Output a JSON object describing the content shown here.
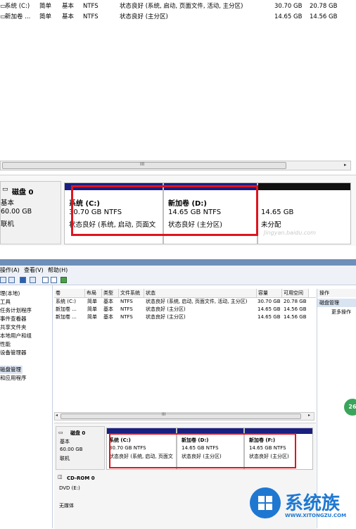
{
  "top": {
    "rows": [
      {
        "name": "系统 (C:)",
        "layout": "简单",
        "type": "基本",
        "fs": "NTFS",
        "status": "状态良好 (系统, 启动, 页面文件, 活动, 主分区)",
        "capacity": "30.70 GB",
        "free": "20.78 GB"
      },
      {
        "name": "新加卷 ...",
        "layout": "简单",
        "type": "基本",
        "fs": "NTFS",
        "status": "状态良好 (主分区)",
        "capacity": "14.65 GB",
        "free": "14.56 GB"
      }
    ],
    "scroll_grip": "III",
    "disk": {
      "title": "磁盘 0",
      "kind": "基本",
      "size": "60.00 GB",
      "state": "联机"
    },
    "partitions": [
      {
        "name": "系统  (C:)",
        "size": "30.70 GB NTFS",
        "status": "状态良好 (系统, 启动, 页面文"
      },
      {
        "name": "新加卷  (D:)",
        "size": "14.65 GB NTFS",
        "status": "状态良好 (主分区)"
      },
      {
        "name": "",
        "size": "14.65 GB",
        "status": "未分配"
      }
    ],
    "watermark": "Jingyan.baidu.com"
  },
  "bottom": {
    "menu": [
      "操作(A)",
      "查看(V)",
      "帮助(H)"
    ],
    "tree": [
      "理(本地)",
      "工具",
      "任务计划程序",
      "事件查看器",
      "共享文件夹",
      "本地用户和组",
      "性能",
      "设备管理器",
      "磁盘管理",
      "和应用程序"
    ],
    "columns": [
      "卷",
      "布局",
      "类型",
      "文件系统",
      "状态",
      "容量",
      "可用空间",
      "操作"
    ],
    "rows": [
      {
        "name": "系统 (C:)",
        "layout": "简单",
        "type": "基本",
        "fs": "NTFS",
        "status": "状态良好 (系统, 启动, 页面文件, 活动, 主分区)",
        "capacity": "30.70 GB",
        "free": "20.78 GB"
      },
      {
        "name": "新加卷 ...",
        "layout": "简单",
        "type": "基本",
        "fs": "NTFS",
        "status": "状态良好 (主分区)",
        "capacity": "14.65 GB",
        "free": "14.56 GB"
      },
      {
        "name": "新加卷 ...",
        "layout": "简单",
        "type": "基本",
        "fs": "NTFS",
        "status": "状态良好 (主分区)",
        "capacity": "14.65 GB",
        "free": "14.56 GB"
      }
    ],
    "actions": {
      "title": "操作",
      "section": "磁盘管理",
      "more": "更多操作"
    },
    "scroll_grip": "III",
    "disk": {
      "title": "磁盘 0",
      "kind": "基本",
      "size": "60.00 GB",
      "state": "联机"
    },
    "partitions": [
      {
        "name": "系统  (C:)",
        "size": "30.70 GB NTFS",
        "status": "状态良好 (系统, 启动, 页面文"
      },
      {
        "name": "新加卷  (D:)",
        "size": "14.65 GB NTFS",
        "status": "状态良好 (主分区)"
      },
      {
        "name": "新加卷  (F:)",
        "size": "14.65 GB NTFS",
        "status": "状态良好 (主分区)"
      }
    ],
    "cdrom": {
      "title": "CD-ROM 0",
      "drive": "DVD (E:)",
      "state": "无媒体"
    },
    "badge": "26"
  },
  "logo": {
    "text": "系统族",
    "url": "WWW.XITONGZU.COM"
  },
  "colors": {
    "partition_bar": "#1a1f80",
    "unallocated_bar": "#101010",
    "highlight": "#e0141e",
    "logo_blue": "#1e78d2"
  }
}
